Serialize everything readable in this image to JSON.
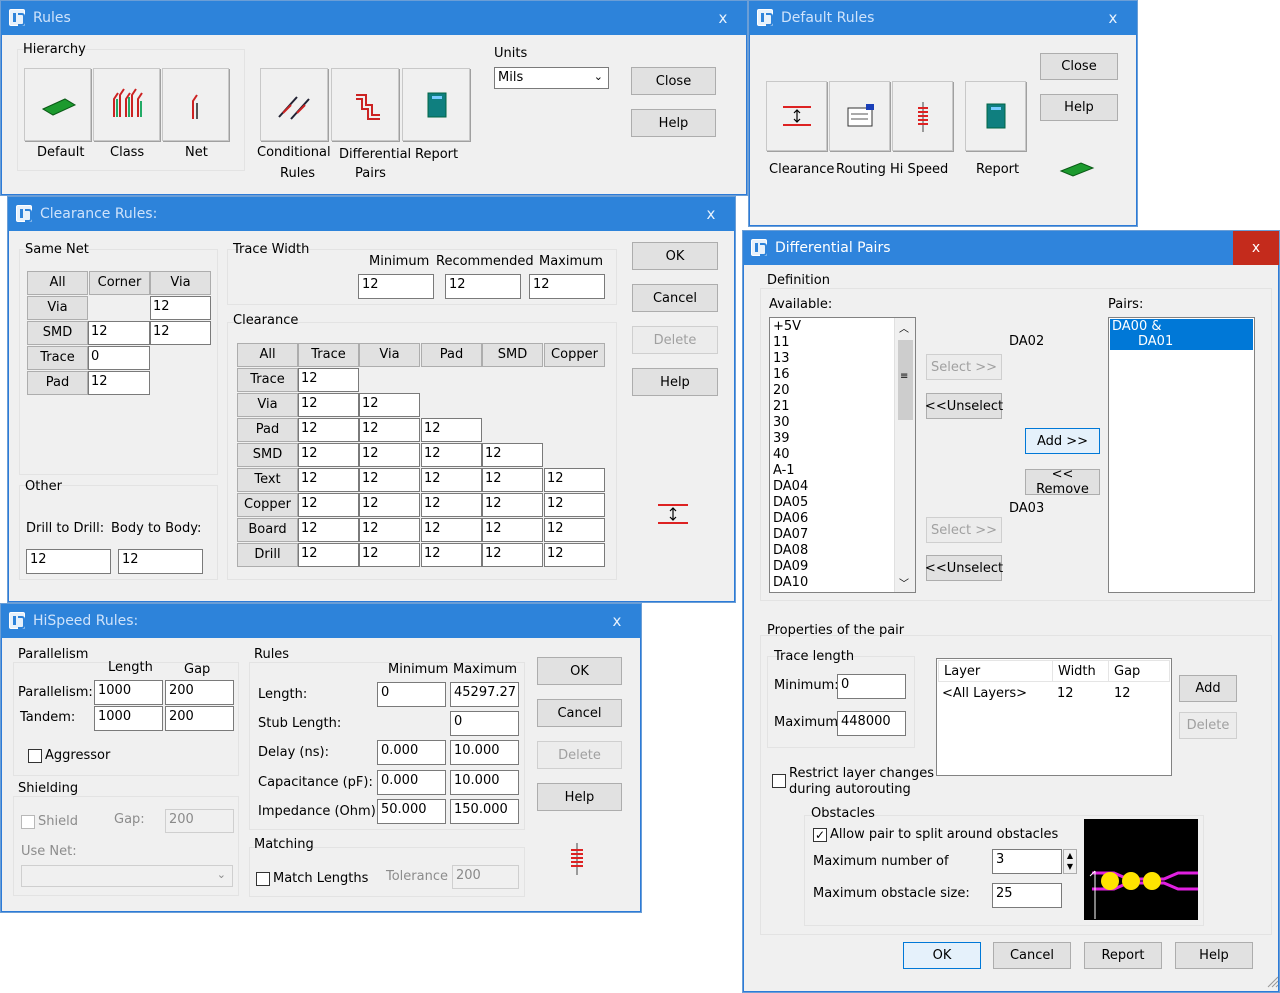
{
  "rules": {
    "title": "Rules",
    "close": "x",
    "hierarchy": "Hierarchy",
    "units_label": "Units",
    "units_value": "Mils",
    "tiles": [
      "Default",
      "Class",
      "Net",
      "Conditional",
      "Rules",
      "Differential",
      "Pairs",
      "Report"
    ],
    "close_btn": "Close",
    "help_btn": "Help"
  },
  "default_rules": {
    "title": "Default Rules",
    "close": "x",
    "close_btn": "Close",
    "help_btn": "Help",
    "tiles": [
      "Clearance",
      "Routing",
      "Hi Speed",
      "Report"
    ]
  },
  "clearance": {
    "title": "Clearance Rules:",
    "close": "x",
    "same_net": "Same Net",
    "sn_headers": [
      "All",
      "Corner",
      "Via"
    ],
    "sn_rows": [
      "Via",
      "SMD",
      "Trace",
      "Pad"
    ],
    "sn_vals": {
      "via_via": "12",
      "smd_corner": "12",
      "smd_via": "12",
      "trace_corner": "0",
      "pad_corner": "12"
    },
    "trace_width": "Trace Width",
    "tw_labels": [
      "Minimum",
      "Recommended",
      "Maximum"
    ],
    "tw_vals": [
      "12",
      "12",
      "12"
    ],
    "clearance_label": "Clearance",
    "cl_headers": [
      "All",
      "Trace",
      "Via",
      "Pad",
      "SMD",
      "Copper"
    ],
    "cl_rows": [
      "Trace",
      "Via",
      "Pad",
      "SMD",
      "Text",
      "Copper",
      "Board",
      "Drill"
    ],
    "cl_val": "12",
    "other": "Other",
    "d2d": "Drill to Drill:",
    "b2b": "Body to Body:",
    "d2d_val": "12",
    "b2b_val": "12",
    "ok": "OK",
    "cancel": "Cancel",
    "delete": "Delete",
    "help": "Help"
  },
  "hispeed": {
    "title": "HiSpeed Rules:",
    "close": "x",
    "parallelism": "Parallelism",
    "length": "Length",
    "gap": "Gap",
    "par_label": "Parallelism:",
    "par_len": "1000",
    "par_gap": "200",
    "tan_label": "Tandem:",
    "tan_len": "1000",
    "tan_gap": "200",
    "aggressor": "Aggressor",
    "shielding": "Shielding",
    "shield": "Shield",
    "gap_label": "Gap:",
    "gap_val": "200",
    "use_net": "Use Net:",
    "rules": "Rules",
    "minimum": "Minimum",
    "maximum": "Maximum",
    "r_labels": [
      "Length:",
      "Stub Length:",
      "Delay (ns):",
      "Capacitance (pF):",
      "Impedance (Ohm):"
    ],
    "r_min": [
      "0",
      "",
      "0.000",
      "0.000",
      "50.000"
    ],
    "r_max": [
      "45297.27",
      "0",
      "10.000",
      "10.000",
      "150.000"
    ],
    "matching": "Matching",
    "match_lengths": "Match Lengths",
    "tolerance": "Tolerance",
    "tol_val": "200",
    "ok": "OK",
    "cancel": "Cancel",
    "delete": "Delete",
    "help": "Help"
  },
  "diff": {
    "title": "Differential Pairs",
    "close": "x",
    "definition": "Definition",
    "available": "Available:",
    "pairs": "Pairs:",
    "avail_items": [
      "+5V",
      "11",
      "13",
      "16",
      "20",
      "21",
      "30",
      "39",
      "40",
      "A-1",
      "DA04",
      "DA05",
      "DA06",
      "DA07",
      "DA08",
      "DA09",
      "DA10"
    ],
    "pair_l1": "DA00 &",
    "pair_l2": "DA01",
    "da02": "DA02",
    "da03": "DA03",
    "select": "Select >>",
    "unselect": "<<Unselect",
    "add": "Add >>",
    "remove": "<< Remove",
    "props": "Properties of the pair",
    "trace_length": "Trace length",
    "minimum": "Minimum:",
    "min_val": "0",
    "maximum": "Maximum:",
    "max_val": "448000",
    "layer_headers": [
      "Layer",
      "Width",
      "Gap"
    ],
    "layer_row": [
      "<All Layers>",
      "12",
      "12"
    ],
    "add_btn": "Add",
    "delete_btn": "Delete",
    "restrict1": "Restrict layer changes",
    "restrict2": "during autorouting",
    "obstacles": "Obstacles",
    "allow_split": "Allow pair to split around obstacles",
    "max_num": "Maximum number of",
    "max_num_val": "3",
    "max_size": "Maximum obstacle size:",
    "max_size_val": "25",
    "ok": "OK",
    "cancel": "Cancel",
    "report": "Report",
    "help": "Help",
    "check": "✓"
  }
}
